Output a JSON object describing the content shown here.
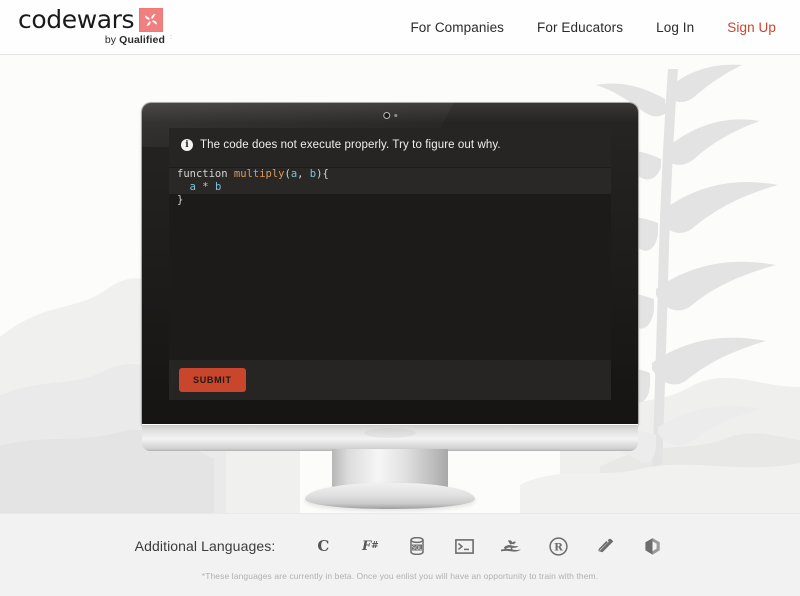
{
  "brand": {
    "name": "codewars",
    "tagline_pre": "by ",
    "tagline_strong": "Qualified",
    "mark_icon": "pinwheel-icon",
    "mark_color": "#f08080"
  },
  "nav": {
    "items": [
      {
        "label": "For Companies",
        "accent": false
      },
      {
        "label": "For Educators",
        "accent": false
      },
      {
        "label": "Log In",
        "accent": false
      },
      {
        "label": "Sign Up",
        "accent": true
      }
    ],
    "accent_color": "#c9452d"
  },
  "hero": {
    "background": "faint-pine-tree-and-mountain-landscape",
    "device": "desktop-monitor",
    "app": {
      "message": "The code does not execute properly. Try to figure out why.",
      "message_icon": "info-circle-icon",
      "code_lines": [
        {
          "highlighted": true,
          "tokens": [
            {
              "t": "function",
              "c": "kw"
            },
            {
              "t": " ",
              "c": "punc"
            },
            {
              "t": "multiply",
              "c": "fn"
            },
            {
              "t": "(",
              "c": "punc"
            },
            {
              "t": "a",
              "c": "var"
            },
            {
              "t": ", ",
              "c": "punc"
            },
            {
              "t": "b",
              "c": "var"
            },
            {
              "t": "){",
              "c": "punc"
            }
          ]
        },
        {
          "highlighted": true,
          "tokens": [
            {
              "t": "  ",
              "c": "punc"
            },
            {
              "t": "a",
              "c": "var"
            },
            {
              "t": " * ",
              "c": "op"
            },
            {
              "t": "b",
              "c": "var"
            }
          ]
        },
        {
          "highlighted": false,
          "tokens": [
            {
              "t": "}",
              "c": "punc"
            }
          ]
        }
      ],
      "submit_label": "SUBMIT",
      "submit_color": "#c9462c"
    }
  },
  "footer": {
    "languages_label": "Additional Languages:",
    "languages": [
      {
        "name": "C",
        "icon": "c-language-icon"
      },
      {
        "name": "F#",
        "icon": "fsharp-language-icon"
      },
      {
        "name": "SQL",
        "icon": "sql-database-icon"
      },
      {
        "name": "Shell",
        "icon": "shell-terminal-icon"
      },
      {
        "name": "OCaml",
        "icon": "ocaml-camel-icon"
      },
      {
        "name": "R",
        "icon": "r-language-icon"
      },
      {
        "name": "Crystal",
        "icon": "crystal-language-icon"
      },
      {
        "name": "Nim",
        "icon": "nim-crown-icon"
      }
    ],
    "footnote": "*These languages are currently in beta. Once you enlist you will have an opportunity to train with them."
  }
}
